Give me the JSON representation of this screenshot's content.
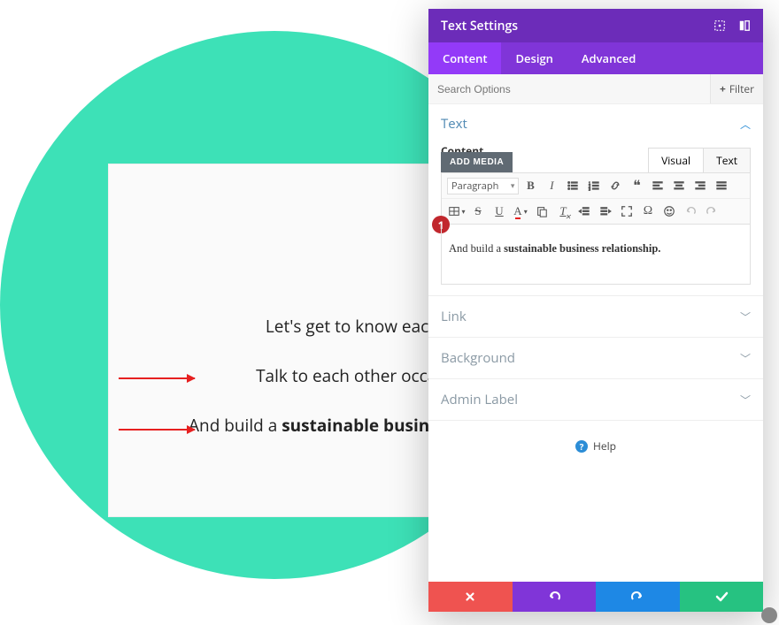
{
  "panel": {
    "title": "Text Settings",
    "tabs": {
      "content": "Content",
      "design": "Design",
      "advanced": "Advanced"
    },
    "search": {
      "placeholder": "Search Options",
      "filter": "Filter"
    },
    "sections": {
      "text": {
        "title": "Text",
        "content_label": "Content",
        "add_media": "ADD MEDIA",
        "editor_tabs": {
          "visual": "Visual",
          "text": "Text"
        },
        "paragraph_selector": "Paragraph",
        "editor_content_prefix": "And build a ",
        "editor_content_bold": "sustainable business relationship."
      },
      "link": "Link",
      "background": "Background",
      "admin_label": "Admin Label"
    },
    "help": "Help",
    "badge": "1"
  },
  "canvas": {
    "line1": "Let's get to know each other.",
    "line2": "Talk to each other occasionally.",
    "line3_prefix": "And build a ",
    "line3_bold": "sustainable business relationship."
  }
}
